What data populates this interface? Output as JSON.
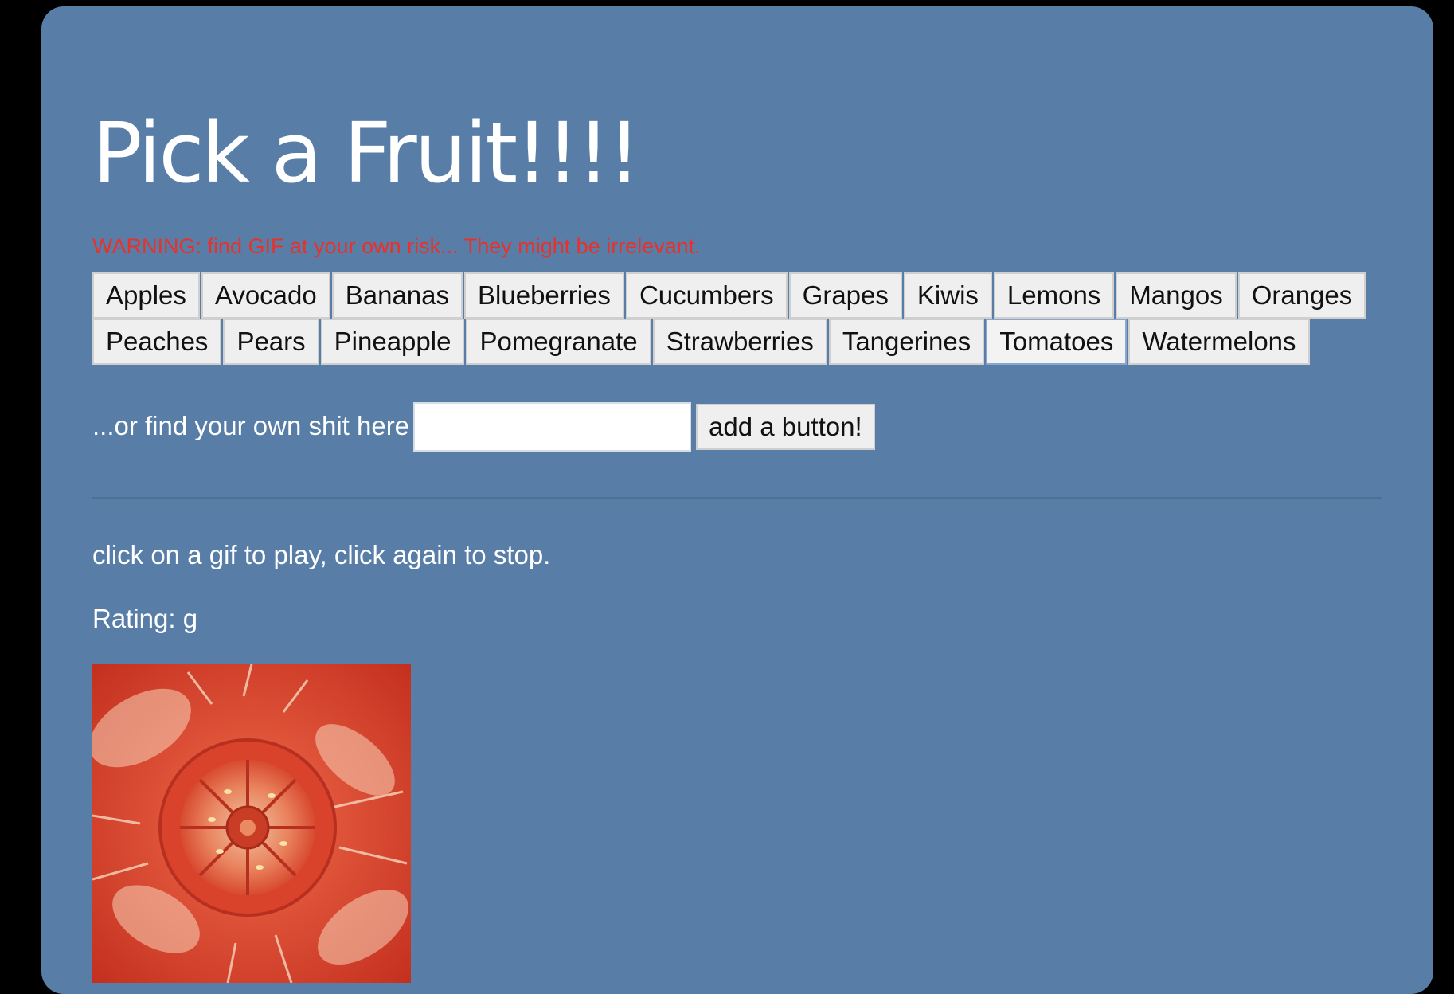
{
  "page": {
    "title": "Pick a Fruit!!!!",
    "warning": "WARNING: find GIF at your own risk... They might be irrelevant.",
    "warning_color": "#e8312b",
    "background_color": "#587ea8"
  },
  "fruit_buttons": {
    "row1": [
      "Apples",
      "Avocado",
      "Bananas",
      "Blueberries",
      "Cucumbers",
      "Grapes",
      "Kiwis",
      "Lemons",
      "Mangos",
      "Oranges"
    ],
    "row2": [
      "Peaches",
      "Pears",
      "Pineapple",
      "Pomegranate",
      "Strawberries",
      "Tangerines",
      "Tomatoes",
      "Watermelons"
    ],
    "focused": "Tomatoes"
  },
  "search": {
    "label": "...or find your own shit here",
    "value": "",
    "placeholder": "",
    "button_label": "add a button!"
  },
  "results": {
    "instructions": "click on a gif to play, click again to stop.",
    "rating": "Rating: g",
    "gif_subject": "tomato-slice"
  }
}
